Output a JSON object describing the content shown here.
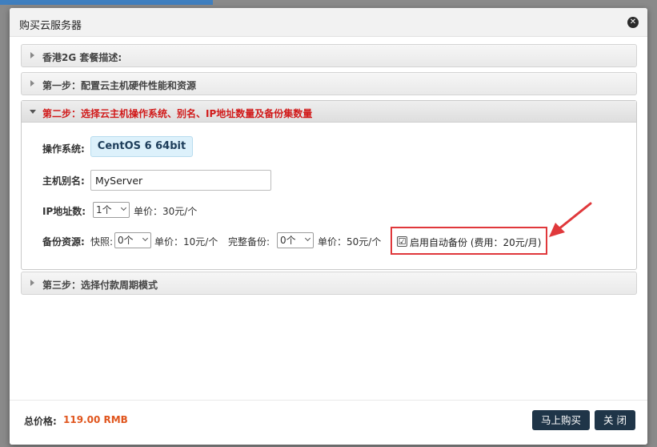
{
  "modal": {
    "title": "购买云服务器"
  },
  "sections": [
    {
      "title": "香港2G 套餐描述:"
    },
    {
      "title": "第一步：配置云主机硬件性能和资源"
    },
    {
      "title": "第二步：选择云主机操作系统、别名、IP地址数量及备份集数量"
    },
    {
      "title": "第三步：选择付款周期模式"
    }
  ],
  "step2": {
    "os_label": "操作系统:",
    "os_value": "CentOS 6 64bit",
    "alias_label": "主机别名:",
    "alias_value": "MyServer",
    "ip_label": "IP地址数:",
    "ip_selected": "1个",
    "ip_price": "单价：30元/个",
    "backup_label": "备份资源:",
    "snapshot_label": "快照:",
    "snapshot_selected": "0个",
    "snapshot_price": "单价：10元/个",
    "full_backup_label": "完整备份:",
    "full_backup_selected": "0个",
    "full_backup_price": "单价：50元/个",
    "auto_backup_checked": "☑",
    "auto_backup_label": "启用自动备份 (费用：20元/月)"
  },
  "footer": {
    "total_label": "总价格:",
    "total_value": "119.00 RMB",
    "buy_label": "马上购买",
    "close_label": "关 闭"
  },
  "colors": {
    "accent_red": "#d11a1a",
    "price_orange": "#e0551d",
    "button_dark": "#1f3548",
    "highlight_box": "#e0383b"
  },
  "icons": {
    "close": "close-icon",
    "collapsed": "caret-right-icon",
    "expanded": "caret-down-icon"
  }
}
